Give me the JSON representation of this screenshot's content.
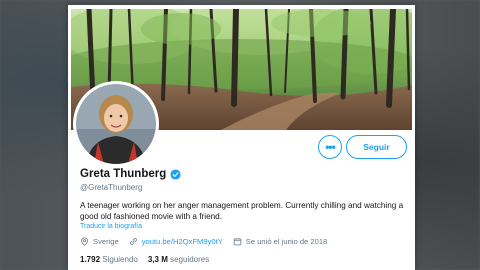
{
  "profile": {
    "name": "Greta Thunberg",
    "handle": "@GretaThunberg",
    "bio": "A teenager working on her anger management problem. Currently chilling and watching a good old fashioned movie with a friend.",
    "translate_label": "Traducir la biografía",
    "location": "Sverige",
    "website": "youtu.be/H2QxFM9y0tY",
    "joined": "Se unió el junio de 2018",
    "verified": true
  },
  "actions": {
    "more_label": "•••",
    "follow_label": "Seguir"
  },
  "stats": {
    "following_count": "1.792",
    "following_label": "Siguiendo",
    "followers_count": "3,3 M",
    "followers_label": "seguidores"
  },
  "colors": {
    "accent": "#1da1f2",
    "text": "#14171a",
    "muted": "#657786"
  },
  "icons": {
    "verified": "verified-badge-icon",
    "location": "location-pin-icon",
    "link": "link-icon",
    "calendar": "calendar-icon",
    "more": "more-options-icon"
  }
}
